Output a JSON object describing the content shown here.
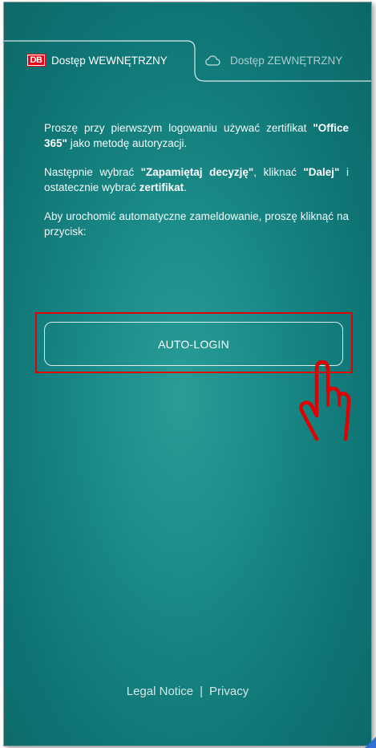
{
  "tabs": {
    "internal": {
      "logo_text": "DB",
      "label": "Dostęp WEWNĘTRZNY",
      "icon": "db-logo"
    },
    "external": {
      "label": "Dostęp ZEWNĘTRZNY",
      "icon": "cloud-icon"
    }
  },
  "instructions": {
    "p1_a": "Proszę przy pierwszym logowaniu używać zertifikat ",
    "p1_b": "\"Office 365\"",
    "p1_c": " jako metodę autoryzacji.",
    "p2_a": "Następnie wybrać ",
    "p2_b": "\"Zapamiętaj decyzję\"",
    "p2_c": ", kliknać ",
    "p2_d": "\"Dalej\"",
    "p2_e": " i ostatecznie wybrać ",
    "p2_f": "zertifikat",
    "p2_g": ".",
    "p3": "Aby urochomić automatyczne zameldowanie, proszę kliknąć na przycisk:"
  },
  "auto_login": {
    "label": "AUTO-LOGIN"
  },
  "footer": {
    "legal": "Legal Notice",
    "separator": "|",
    "privacy": "Privacy"
  },
  "colors": {
    "background": "#137b79",
    "highlight": "#e00000",
    "db_red": "#ec0016",
    "text": "#ffffff"
  }
}
